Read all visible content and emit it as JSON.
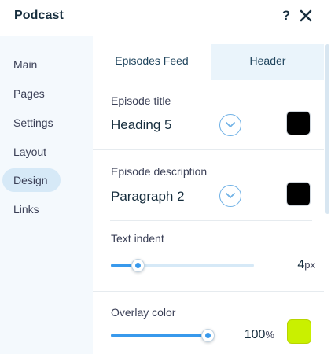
{
  "header": {
    "title": "Podcast",
    "help_label": "?"
  },
  "sidebar": {
    "items": [
      {
        "label": "Main"
      },
      {
        "label": "Pages"
      },
      {
        "label": "Settings"
      },
      {
        "label": "Layout"
      },
      {
        "label": "Design",
        "active": true
      },
      {
        "label": "Links"
      }
    ]
  },
  "tabs": [
    {
      "label": "Episodes Feed",
      "active": true
    },
    {
      "label": "Header",
      "active": false
    }
  ],
  "episode_title": {
    "label": "Episode title",
    "value": "Heading 5",
    "color": "#000000"
  },
  "episode_description": {
    "label": "Episode description",
    "value": "Paragraph 2",
    "color": "#000000"
  },
  "text_indent": {
    "label": "Text indent",
    "value": "4",
    "unit": "px",
    "fraction": 0.19
  },
  "overlay_color": {
    "label": "Overlay color",
    "value": "100",
    "unit": "%",
    "fraction": 1.0,
    "color": "#c9f000"
  },
  "colors": {
    "accent": "#3899ec",
    "nav_active_bg": "#d6e9f7",
    "sidebar_bg": "#f4f9fd"
  }
}
